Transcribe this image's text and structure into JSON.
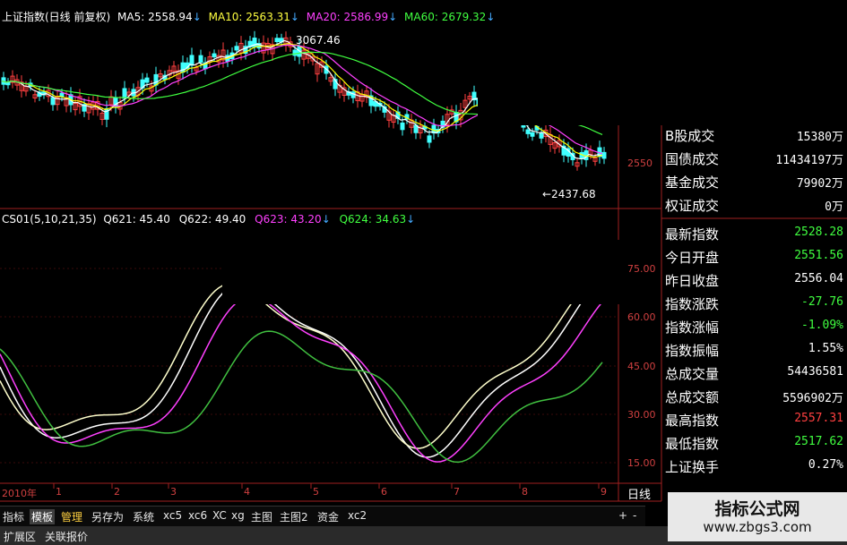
{
  "main_chart": {
    "title": "上证指数(日线 前复权)",
    "ma5": "MA5: 2558.94",
    "ma10": "MA10: 2563.31",
    "ma20": "MA20: 2586.99",
    "ma60": "MA60: 2679.32",
    "arrow": "↓",
    "high_label": "3067.46",
    "low_label": "←2437.68",
    "price_tick": "2550",
    "colors": {
      "ma5": "#ffffff",
      "ma10": "#ffff00",
      "ma20": "#ff40ff",
      "ma60": "#40ff40"
    }
  },
  "indicator": {
    "name": "CS01(5,10,21,35)",
    "q621": "Q621: 45.40",
    "q622": "Q622: 49.40",
    "q623": "Q623: 43.20",
    "q624": "Q624: 34.63",
    "yticks": [
      "75.00",
      "60.00",
      "45.00",
      "30.00",
      "15.00"
    ]
  },
  "time_axis": {
    "year": "2010年",
    "months": [
      "1",
      "2",
      "3",
      "4",
      "5",
      "6",
      "7",
      "8",
      "9"
    ]
  },
  "period_label": "日线",
  "toolbar": {
    "items": [
      "指标",
      "模板",
      "管理",
      "另存为",
      "系统",
      "xc5",
      "xc6",
      "XC",
      "xg",
      "主图",
      "主图2",
      "资金",
      "xc2"
    ],
    "active": "模板",
    "plus": "+",
    "minus": "-"
  },
  "bottom_bar": {
    "items": [
      "扩展区",
      "关联报价"
    ]
  },
  "panel": {
    "rows": [
      {
        "label": "B股成交",
        "value": "15380万",
        "color": "#ffffff"
      },
      {
        "label": "国债成交",
        "value": "11434197万",
        "color": "#ffffff"
      },
      {
        "label": "基金成交",
        "value": "79902万",
        "color": "#ffffff"
      },
      {
        "label": "权证成交",
        "value": "0万",
        "color": "#ffffff"
      },
      {
        "label": "最新指数",
        "value": "2528.28",
        "color": "#40ff40"
      },
      {
        "label": "今日开盘",
        "value": "2551.56",
        "color": "#40ff40"
      },
      {
        "label": "昨日收盘",
        "value": "2556.04",
        "color": "#ffffff"
      },
      {
        "label": "指数涨跌",
        "value": "-27.76",
        "color": "#40ff40"
      },
      {
        "label": "指数涨幅",
        "value": "-1.09%",
        "color": "#40ff40"
      },
      {
        "label": "指数振幅",
        "value": "1.55%",
        "color": "#ffffff"
      },
      {
        "label": "总成交量",
        "value": "54436581",
        "color": "#ffffff"
      },
      {
        "label": "总成交额",
        "value": "5596902万",
        "color": "#ffffff"
      },
      {
        "label": "最高指数",
        "value": "2557.31",
        "color": "#ff4040"
      },
      {
        "label": "最低指数",
        "value": "2517.62",
        "color": "#40ff40"
      },
      {
        "label": "上证换手",
        "value": "0.27%",
        "color": "#ffffff"
      }
    ]
  },
  "watermark": {
    "title": "指标公式网",
    "url": "www.zbgs3.com"
  }
}
